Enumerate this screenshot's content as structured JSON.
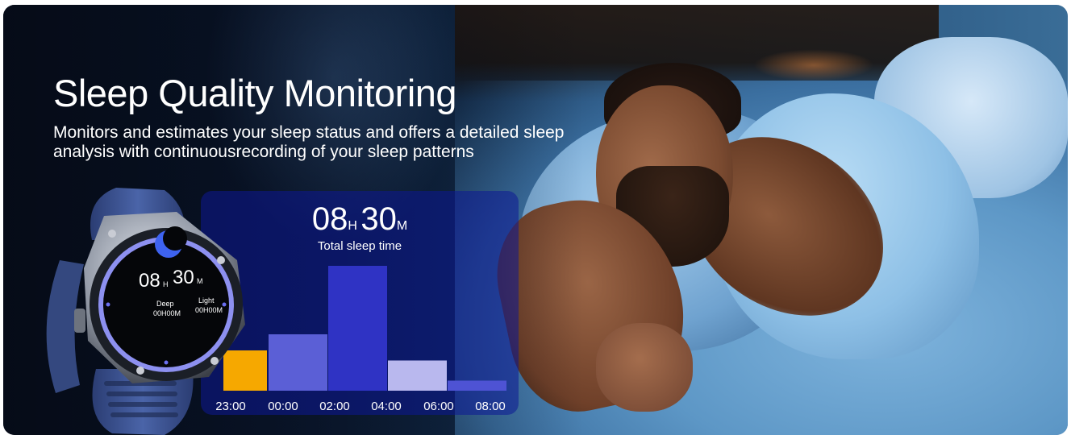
{
  "banner": {
    "title": "Sleep Quality Monitoring",
    "subtitle": "Monitors and estimates your sleep status and offers a detailed sleep analysis with continuousrecording of your sleep patterns"
  },
  "sleep_summary": {
    "hours": "08",
    "hours_unit": "H",
    "minutes": "30",
    "minutes_unit": "M",
    "label": "Total sleep time"
  },
  "watch_display": {
    "hours": "08",
    "hours_unit": "H",
    "minutes": "30",
    "minutes_unit": "M",
    "deep_label": "Deep",
    "deep_value": "00H00M",
    "light_label": "Light",
    "light_value": "00H00M",
    "moon_icon": "crescent-moon-icon"
  },
  "chart_data": {
    "type": "bar",
    "categories": [
      "23:00",
      "00:00",
      "02:00",
      "04:00",
      "06:00",
      "08:00"
    ],
    "values": [
      1.0,
      1.4,
      3.1,
      0.75,
      0.25
    ],
    "bar_colors": [
      "#f6a800",
      "#5b5fd6",
      "#2f33c4",
      "#b9b8ee",
      "#4e53d4"
    ],
    "ylim": [
      0,
      3.2
    ],
    "grid": false,
    "xlabel": "",
    "ylabel": ""
  }
}
